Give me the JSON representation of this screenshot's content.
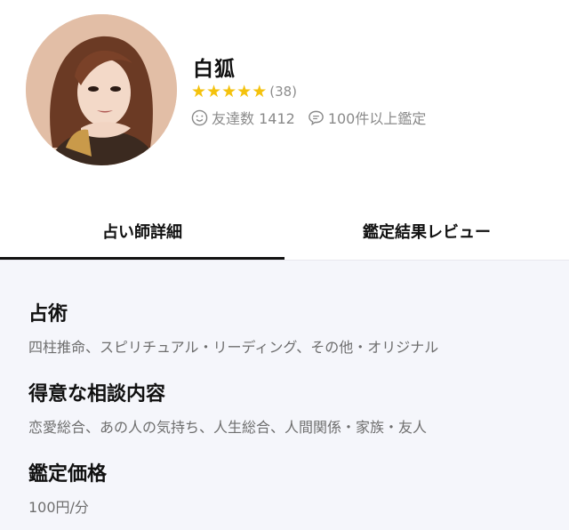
{
  "profile": {
    "name": "白狐",
    "rating": {
      "stars": 5,
      "count_label": "(38)"
    },
    "stats": {
      "friends_label": "友達数 1412",
      "readings_label": "100件以上鑑定"
    }
  },
  "tabs": [
    {
      "label": "占い師詳細",
      "active": true
    },
    {
      "label": "鑑定結果レビュー",
      "active": false
    }
  ],
  "details": {
    "divination": {
      "title": "占術",
      "body": "四柱推命、スピリチュアル・リーディング、その他・オリジナル"
    },
    "specialty": {
      "title": "得意な相談内容",
      "body": "恋愛総合、あの人の気持ち、人生総合、人間関係・家族・友人"
    },
    "price": {
      "title": "鑑定価格",
      "body": "100円/分"
    }
  },
  "colors": {
    "star": "#f4c20d",
    "details_bg": "#f5f6fb",
    "muted_text": "#8a8a8a"
  }
}
